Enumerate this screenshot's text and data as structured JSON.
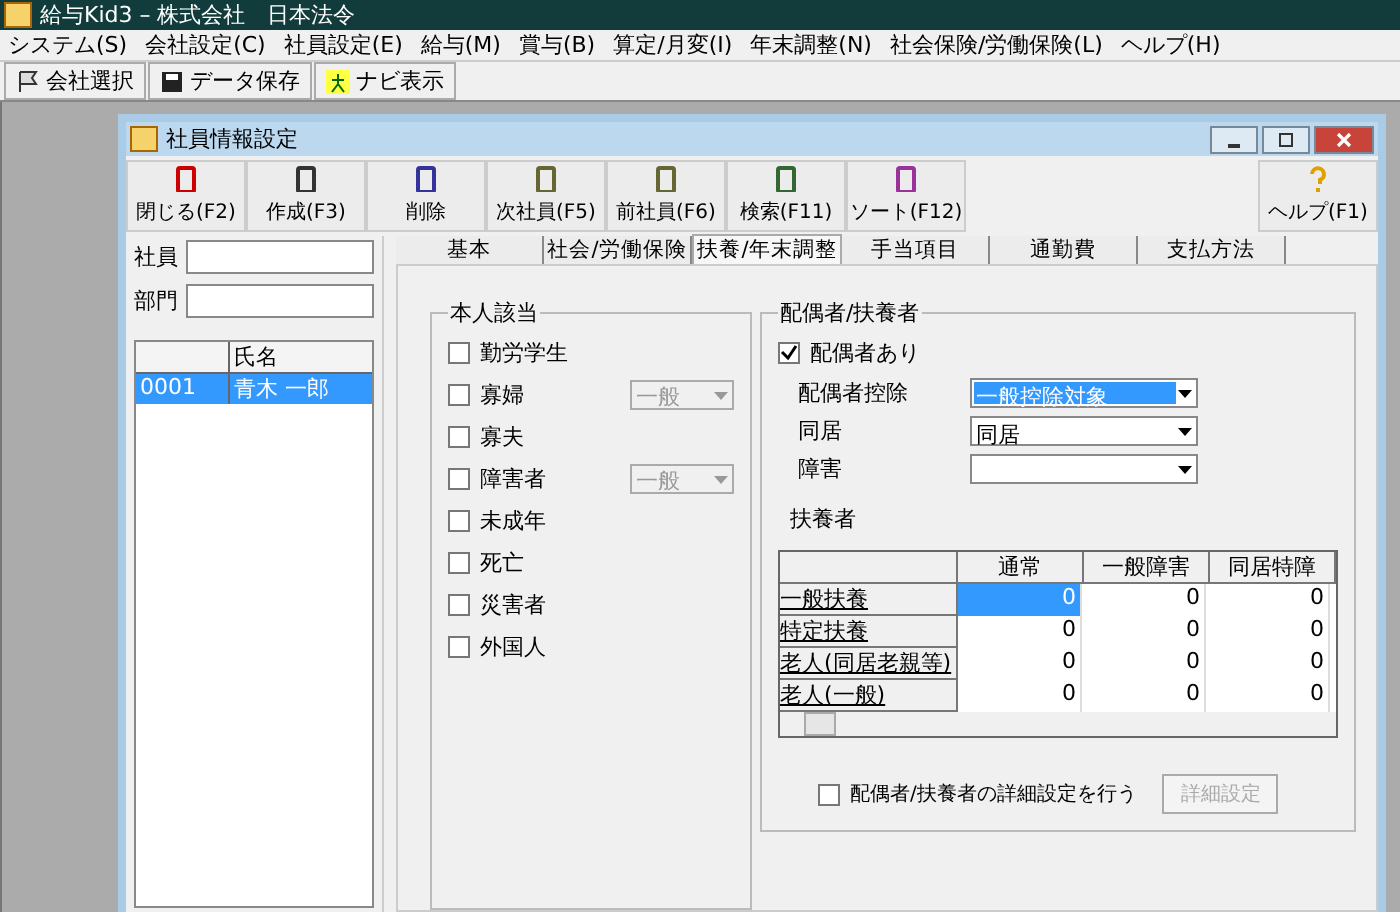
{
  "window": {
    "title": "給与Kid3 – 株式会社　日本法令"
  },
  "menu": [
    "システム(S)",
    "会社設定(C)",
    "社員設定(E)",
    "給与(M)",
    "賞与(B)",
    "算定/月変(I)",
    "年末調整(N)",
    "社会保険/労働保険(L)",
    "ヘルプ(H)"
  ],
  "toolbar": [
    "会社選択",
    "データ保存",
    "ナビ表示"
  ],
  "child_window": {
    "title": "社員情報設定",
    "toolbar": [
      "閉じる(F2)",
      "作成(F3)",
      "削除",
      "次社員(F5)",
      "前社員(F6)",
      "検索(F11)",
      "ソート(F12)"
    ],
    "help_button": "ヘルプ(F1)",
    "employee_label": "社員",
    "department_label": "部門",
    "list": {
      "columns": [
        "",
        "氏名"
      ],
      "rows": [
        {
          "code": "0001",
          "name": "青木 一郎",
          "selected": true
        }
      ]
    },
    "tabs": [
      {
        "label": "基本",
        "selected": false
      },
      {
        "label": "社会/労働保険",
        "selected": false
      },
      {
        "label": "扶養/年末調整",
        "selected": true
      },
      {
        "label": "手当項目",
        "selected": false
      },
      {
        "label": "通勤費",
        "selected": false
      },
      {
        "label": "支払方法",
        "selected": false
      }
    ],
    "self_group": {
      "title": "本人該当",
      "items": [
        {
          "kind": "checkbox",
          "label": "勤労学生",
          "checked": false
        },
        {
          "kind": "checkbox_select",
          "label": "寡婦",
          "checked": false,
          "select_value": "一般",
          "select_disabled": true
        },
        {
          "kind": "checkbox",
          "label": "寡夫",
          "checked": false
        },
        {
          "kind": "checkbox_select",
          "label": "障害者",
          "checked": false,
          "select_value": "一般",
          "select_disabled": true
        },
        {
          "kind": "checkbox",
          "label": "未成年",
          "checked": false
        },
        {
          "kind": "checkbox",
          "label": "死亡",
          "checked": false
        },
        {
          "kind": "checkbox",
          "label": "災害者",
          "checked": false
        },
        {
          "kind": "checkbox",
          "label": "外国人",
          "checked": false
        }
      ]
    },
    "spouse_group": {
      "title": "配偶者/扶養者",
      "has_spouse": {
        "label": "配偶者あり",
        "checked": true
      },
      "fields": [
        {
          "label": "配偶者控除",
          "value": "一般控除対象",
          "selected": true
        },
        {
          "label": "同居",
          "value": "同居",
          "selected": false
        },
        {
          "label": "障害",
          "selected": false
        }
      ],
      "dependents_label": "扶養者",
      "table": {
        "columns": [
          "",
          "通常",
          "一般障害",
          "同居特障"
        ],
        "rows": [
          {
            "label": "一般扶養",
            "cells": [
              {
                "value": "0",
                "selected": true
              },
              {
                "value": "0",
                "selected": false
              },
              {
                "value": "0",
                "selected": false
              }
            ]
          },
          {
            "label": "特定扶養",
            "cells": [
              {
                "value": "0",
                "selected": false
              },
              {
                "value": "0",
                "selected": false
              },
              {
                "value": "0",
                "selected": false
              }
            ]
          },
          {
            "label": "老人(同居老親等)",
            "cells": [
              {
                "value": "0",
                "selected": false
              },
              {
                "value": "0",
                "selected": false
              },
              {
                "value": "0",
                "selected": false
              }
            ]
          },
          {
            "label": "老人(一般)",
            "cells": [
              {
                "value": "0",
                "selected": false
              },
              {
                "value": "0",
                "selected": false
              },
              {
                "value": "0",
                "selected": false
              }
            ]
          }
        ]
      },
      "detail_checkbox": {
        "label": "配偶者/扶養者の詳細設定を行う",
        "checked": false
      },
      "detail_button": {
        "label": "詳細設定",
        "disabled": true
      }
    }
  }
}
